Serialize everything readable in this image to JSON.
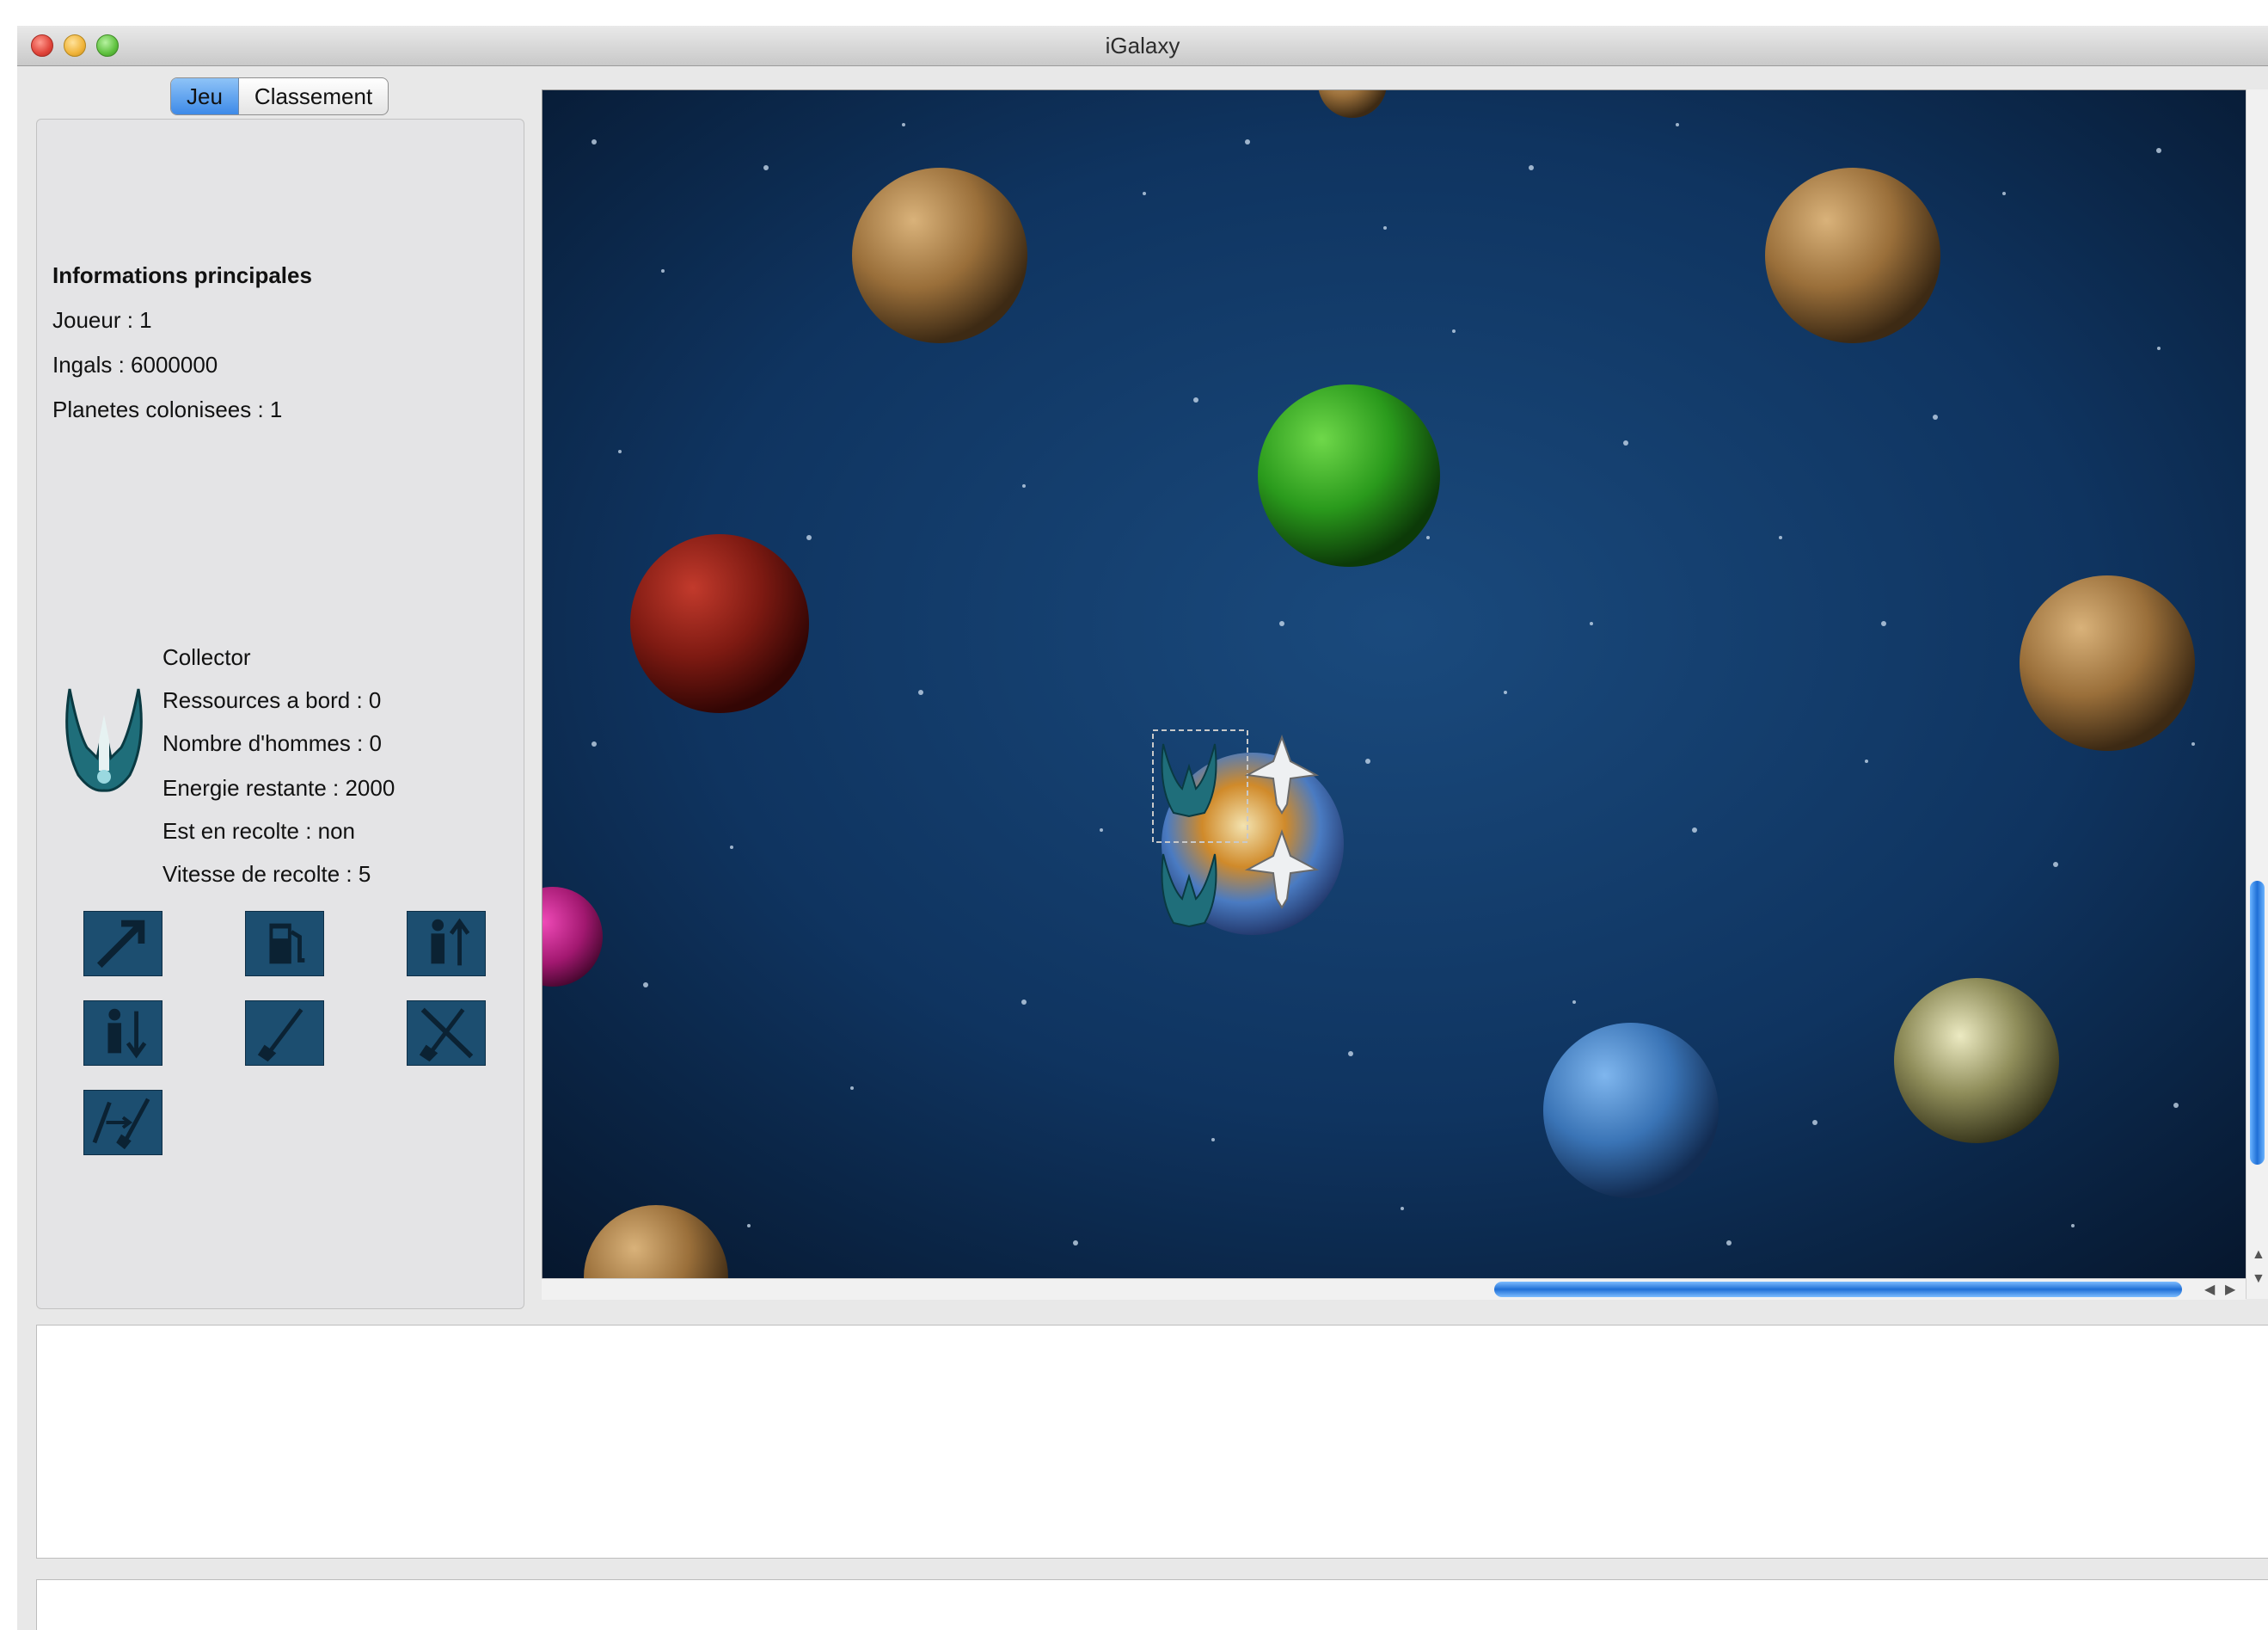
{
  "window": {
    "title": "iGalaxy"
  },
  "tabs": [
    {
      "label": "Jeu",
      "active": true
    },
    {
      "label": "Classement",
      "active": false
    }
  ],
  "info": {
    "heading": "Informations principales",
    "player": "Joueur : 1",
    "ingals": "Ingals : 6000000",
    "planets": "Planetes colonisees : 1"
  },
  "ship": {
    "name": "Collector",
    "resources": "Ressources a bord : 0",
    "men": "Nombre d'hommes : 0",
    "energy": "Energie restante : 2000",
    "harvesting": "Est en recolte : non",
    "harvest_speed": "Vitesse de recolte : 5"
  },
  "actions": [
    {
      "icon": "move-arrow-icon"
    },
    {
      "icon": "fuel-pump-icon"
    },
    {
      "icon": "load-men-icon"
    },
    {
      "icon": "unload-men-icon"
    },
    {
      "icon": "harvest-shovel-icon"
    },
    {
      "icon": "cancel-harvest-icon"
    },
    {
      "icon": "transfer-resources-icon"
    }
  ],
  "colors": {
    "space": "#0d2f57",
    "tab_active": "#3d8ae8",
    "action_button": "#1c4e70"
  }
}
